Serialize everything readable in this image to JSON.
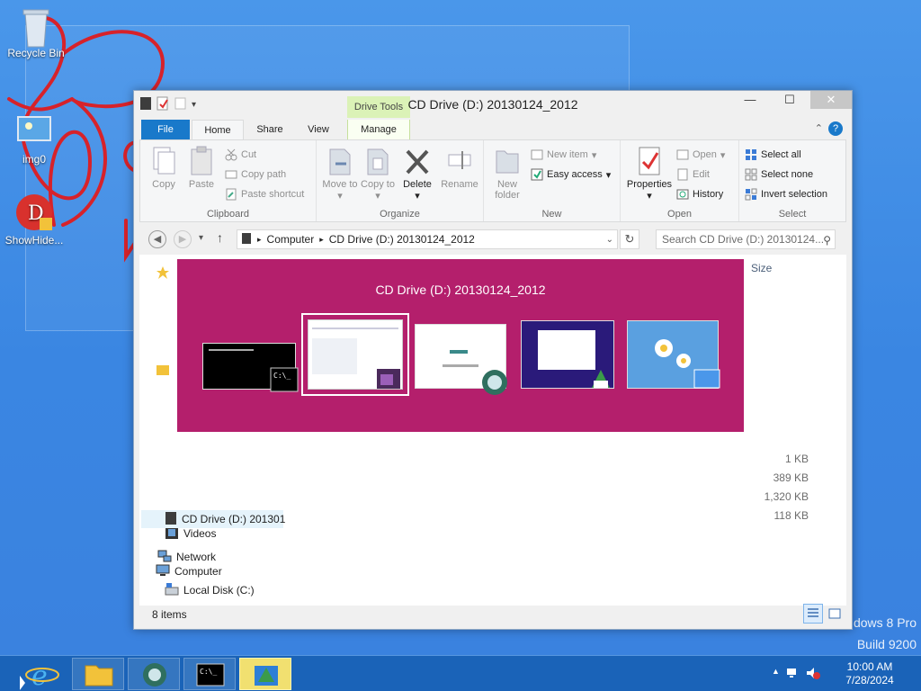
{
  "desktop": {
    "icons": [
      {
        "label": "Recycle Bin",
        "icon": "recycle-bin-icon"
      },
      {
        "label": "img0",
        "icon": "image-file-icon"
      },
      {
        "label": "ShowHide...",
        "icon": "app-shortcut-icon"
      }
    ],
    "watermark": {
      "line1": "ndows 8 Pro",
      "line2": "Build 9200"
    }
  },
  "window": {
    "title": "CD Drive (D:) 20130124_2012",
    "contextual_tab_group": "Drive Tools",
    "tabs": [
      "File",
      "Home",
      "Share",
      "View",
      "Manage"
    ],
    "active_tab": "Home",
    "ribbon": {
      "clipboard": {
        "label": "Clipboard",
        "copy": "Copy",
        "paste": "Paste",
        "cut": "Cut",
        "copy_path": "Copy path",
        "paste_shortcut": "Paste shortcut"
      },
      "organize": {
        "label": "Organize",
        "move_to": "Move to",
        "copy_to": "Copy to",
        "delete": "Delete",
        "rename": "Rename"
      },
      "new": {
        "label": "New",
        "new_folder": "New folder",
        "new_item": "New item",
        "easy_access": "Easy access"
      },
      "open": {
        "label": "Open",
        "properties": "Properties",
        "open": "Open",
        "edit": "Edit",
        "history": "History"
      },
      "select": {
        "label": "Select",
        "select_all": "Select all",
        "select_none": "Select none",
        "invert_selection": "Invert selection"
      }
    },
    "address": {
      "crumbs": [
        "Computer",
        "CD Drive (D:) 20130124_2012"
      ]
    },
    "search": {
      "placeholder": "Search CD Drive (D:) 20130124..."
    },
    "navpane": {
      "videos": "Videos",
      "computer": "Computer",
      "local_disk": "Local Disk (C:)",
      "cd_drive": "CD Drive (D:) 201301",
      "network": "Network"
    },
    "filelist": {
      "size_header": "Size",
      "sizes": [
        "1 KB",
        "389 KB",
        "1,320 KB",
        "118 KB"
      ]
    },
    "status": {
      "item_count": "8 items"
    }
  },
  "switcher": {
    "title": "CD Drive (D:) 20130124_2012",
    "windows": [
      "command-prompt",
      "file-explorer",
      "browser",
      "installer",
      "desktop"
    ],
    "selected_index": 1
  },
  "taskbar": {
    "apps": [
      "internet-explorer-icon",
      "file-explorer-icon",
      "browser-icon",
      "command-prompt-icon",
      "installer-icon"
    ],
    "active_app_index": 4,
    "time": "10:00 AM",
    "date": "7/28/2024"
  }
}
